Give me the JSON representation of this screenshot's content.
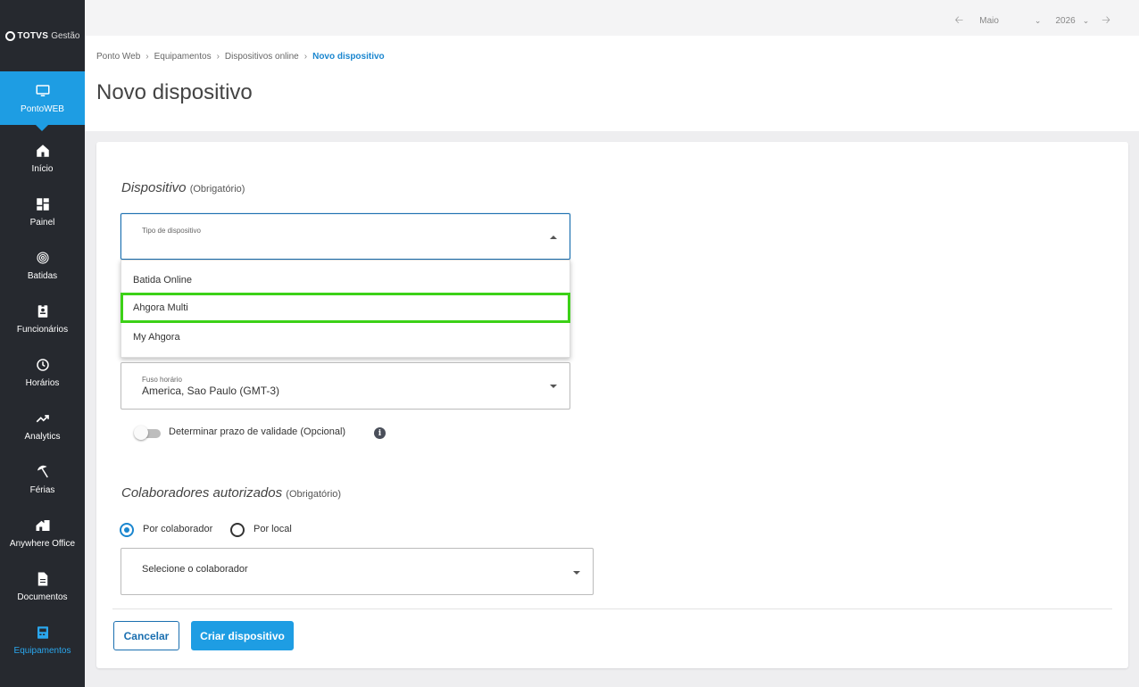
{
  "sidebar": {
    "logo_brand": "TOTVS",
    "logo_sub": "Gestão",
    "items": [
      {
        "label": "PontoWEB"
      },
      {
        "label": "Início"
      },
      {
        "label": "Painel"
      },
      {
        "label": "Batidas"
      },
      {
        "label": "Funcionários"
      },
      {
        "label": "Horários"
      },
      {
        "label": "Analytics"
      },
      {
        "label": "Férias"
      },
      {
        "label": "Anywhere Office"
      },
      {
        "label": "Documentos"
      },
      {
        "label": "Equipamentos"
      }
    ]
  },
  "topbar": {
    "month": "Maio",
    "year": "2026"
  },
  "breadcrumb": [
    "Ponto Web",
    "Equipamentos",
    "Dispositivos online",
    "Novo dispositivo"
  ],
  "page_title": "Novo dispositivo",
  "device_section": {
    "title": "Dispositivo",
    "note": "(Obrigatório)",
    "type_label": "Tipo de dispositivo",
    "options": [
      "Batida Online",
      "Ahgora Multi",
      "My Ahgora"
    ],
    "timezone_label": "Fuso horário",
    "timezone_value": "America, Sao Paulo (GMT-3)",
    "validity_label": "Determinar prazo de validade (Opcional)",
    "info_glyph": "i"
  },
  "collab_section": {
    "title": "Colaboradores autorizados",
    "note": "(Obrigatório)",
    "radio_by_collab": "Por colaborador",
    "radio_by_local": "Por local",
    "collab_placeholder": "Selecione o colaborador"
  },
  "actions": {
    "cancel": "Cancelar",
    "create": "Criar dispositivo"
  }
}
